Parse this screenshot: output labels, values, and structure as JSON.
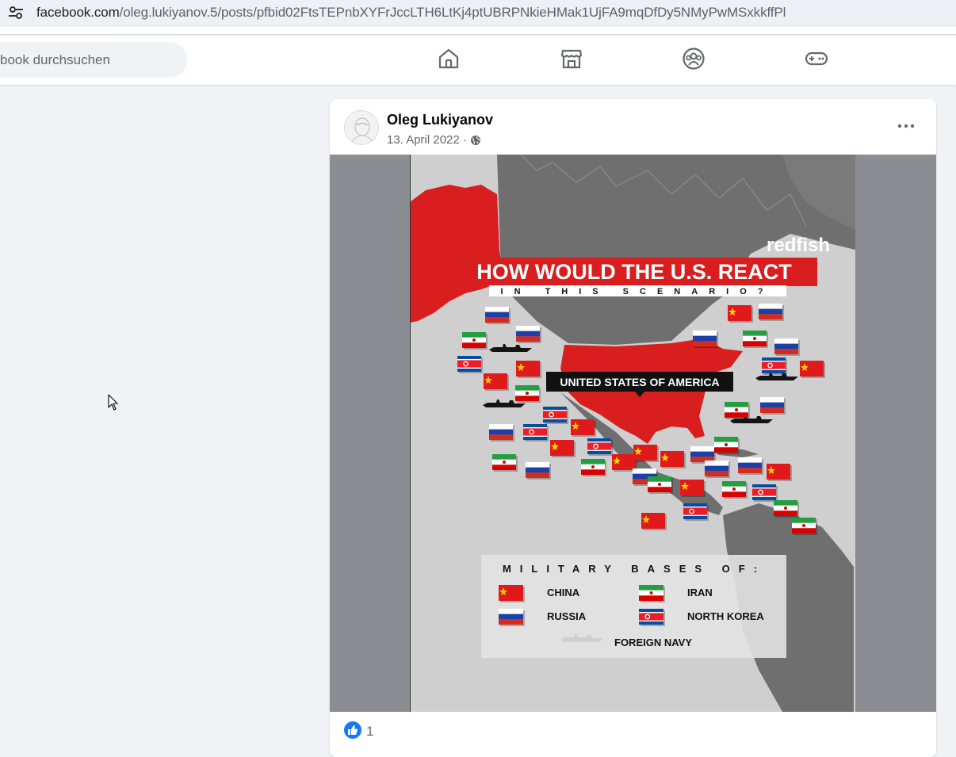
{
  "browser": {
    "url_main": "facebook.com",
    "url_rest": "/oleg.lukiyanov.5/posts/pfbid02FtsTEPnbXYFrJccLTH6LtKj4ptUBRPNkieHMak1UjFA9mqDfDy5NMyPwMSxkkffPl",
    "site_info_icon": "tune-icon"
  },
  "header": {
    "search_placeholder": "book durchsuchen",
    "nav": [
      {
        "name": "home-icon"
      },
      {
        "name": "marketplace-icon"
      },
      {
        "name": "groups-icon"
      },
      {
        "name": "gaming-icon"
      }
    ]
  },
  "post": {
    "author": "Oleg Lukiyanov",
    "date": "13. April 2022",
    "separator": "·",
    "audience_icon": "globe-icon",
    "more_icon": "more-dots-icon",
    "reactions": {
      "icon": "like-icon",
      "count": "1"
    }
  },
  "image": {
    "brand": "redfish",
    "headline": "HOW WOULD THE U.S. REACT",
    "subheadline": "IN THIS SCENARIO?",
    "country_label": "UNITED STATES OF AMERICA",
    "legend_title": "MILITARY BASES OF:",
    "legend": {
      "china": "CHINA",
      "iran": "IRAN",
      "russia": "RUSSIA",
      "north_korea": "NORTH KOREA",
      "navy": "FOREIGN NAVY"
    },
    "colors": {
      "red": "#d81e1e",
      "map_land": "#6f6f6f",
      "sea": "#cfcfcf"
    }
  }
}
